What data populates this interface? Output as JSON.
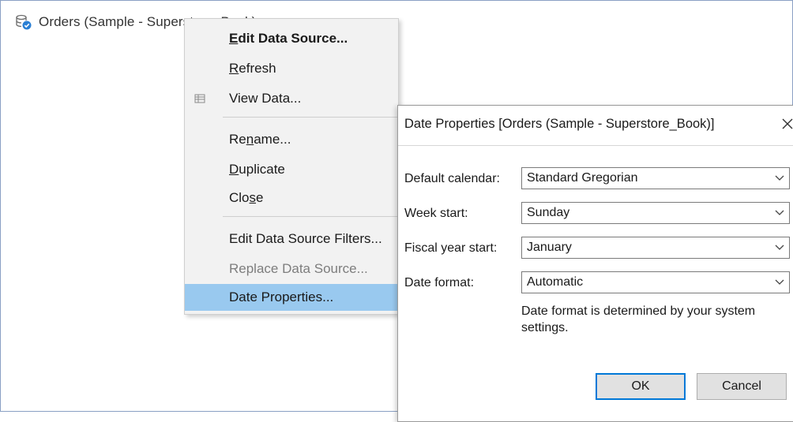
{
  "data_source": {
    "name": "Orders (Sample - Superstore_Book)",
    "icon": "database-connection-icon"
  },
  "context_menu": {
    "items": [
      {
        "label": "Edit Data Source...",
        "bold": true
      },
      {
        "label": "Refresh"
      },
      {
        "label": "View Data...",
        "icon": "view-data-icon"
      },
      {
        "label": "Rename..."
      },
      {
        "label": "Duplicate"
      },
      {
        "label": "Close"
      },
      {
        "label": "Edit Data Source Filters..."
      },
      {
        "label": "Replace Data Source...",
        "disabled": true
      },
      {
        "label": "Date Properties...",
        "highlighted": true
      }
    ]
  },
  "dialog": {
    "title": "Date Properties [Orders (Sample - Superstore_Book)]",
    "close_icon": "close-icon",
    "fields": [
      {
        "label": "Default calendar:",
        "value": "Standard Gregorian"
      },
      {
        "label": "Week start:",
        "value": "Sunday"
      },
      {
        "label": "Fiscal year start:",
        "value": "January"
      },
      {
        "label": "Date format:",
        "value": "Automatic"
      }
    ],
    "note": "Date format is determined by your system settings.",
    "ok_label": "OK",
    "cancel_label": "Cancel"
  },
  "colors": {
    "highlight": "#99c9ef",
    "ok_border": "#0078d7",
    "menu_bg": "#f2f2f2"
  }
}
